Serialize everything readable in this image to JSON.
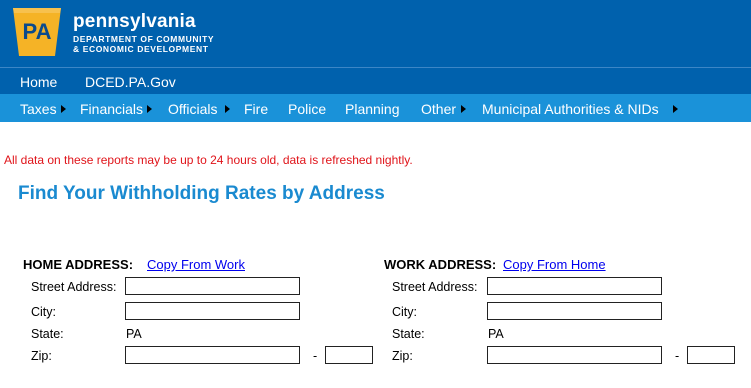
{
  "brand": {
    "logo_text": "PA",
    "name": "pennsylvania",
    "dept_line1": "DEPARTMENT OF COMMUNITY",
    "dept_line2": "& ECONOMIC DEVELOPMENT",
    "logo_color": "#f5b326"
  },
  "nav_top": {
    "home": "Home",
    "dced": "DCED.PA.Gov"
  },
  "nav_sub": {
    "taxes": "Taxes",
    "financials": "Financials",
    "officials": "Officials",
    "fire": "Fire",
    "police": "Police",
    "planning": "Planning",
    "other": "Other",
    "municipal": "Municipal Authorities & NIDs"
  },
  "notice": "All data on these reports may be up to 24 hours old, data is refreshed nightly.",
  "title": "Find Your Withholding Rates by Address",
  "home": {
    "heading": "HOME ADDRESS:",
    "copy_link": "Copy From Work",
    "street_label": "Street Address:",
    "city_label": "City:",
    "state_label": "State:",
    "state_value": "PA",
    "zip_label": "Zip:",
    "street_value": "",
    "city_value": "",
    "zip_value": "",
    "zip_ext_value": ""
  },
  "work": {
    "heading": "WORK ADDRESS:",
    "copy_link": "Copy From Home",
    "street_label": "Street Address:",
    "city_label": "City:",
    "state_label": "State:",
    "state_value": "PA",
    "zip_label": "Zip:",
    "street_value": "",
    "city_value": "",
    "zip_value": "",
    "zip_ext_value": ""
  },
  "zip_separator": "-"
}
